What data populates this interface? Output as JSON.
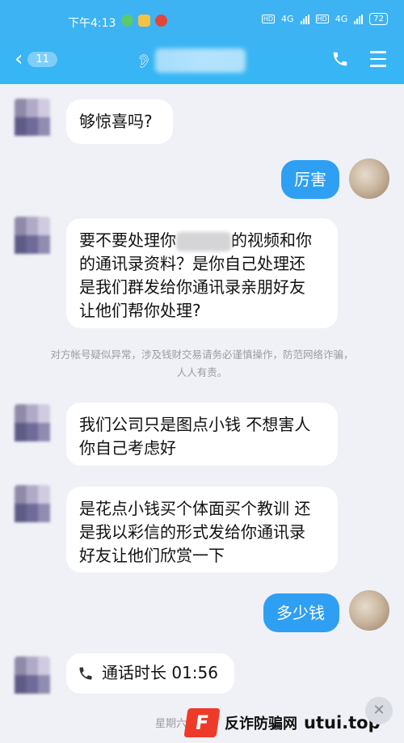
{
  "status_bar": {
    "time": "下午4:13",
    "network_1": "4G",
    "network_2": "4G",
    "battery": "72"
  },
  "nav": {
    "unread_count": "11"
  },
  "messages": [
    {
      "side": "in",
      "text": "够惊喜吗?"
    },
    {
      "side": "out",
      "text": "厉害"
    },
    {
      "side": "in",
      "lines": [
        "要不要处理你",
        "的视频和你",
        "的通讯录资料？是你自己处理还",
        "是我们群发给你通讯录亲朋好友",
        "让他们帮你处理?"
      ]
    },
    {
      "side": "in",
      "lines": [
        "我们公司只是图点小钱  不想害人",
        "你自己考虑好"
      ]
    },
    {
      "side": "in",
      "lines": [
        "是花点小钱买个体面买个教训  还",
        "是我以彩信的形式发给你通讯录",
        "好友让他们欣赏一下"
      ]
    },
    {
      "side": "out",
      "text": "多少钱"
    },
    {
      "side": "in",
      "call_label": "通话时长 01:56"
    }
  ],
  "system_notice": {
    "line1": "对方帐号疑似异常，涉及钱财交易请务必谨慎操作，防范网络诈骗，",
    "line2": "人人有责。"
  },
  "footer": {
    "date_partial": "星期六",
    "watermark_text": "反诈防骗网",
    "watermark_site": "utui.top"
  },
  "colors": {
    "header": "#3db3f3",
    "outgoing_bubble": "#2f9ff3",
    "background": "#eff1f6",
    "watermark_red": "#ee3a28"
  }
}
